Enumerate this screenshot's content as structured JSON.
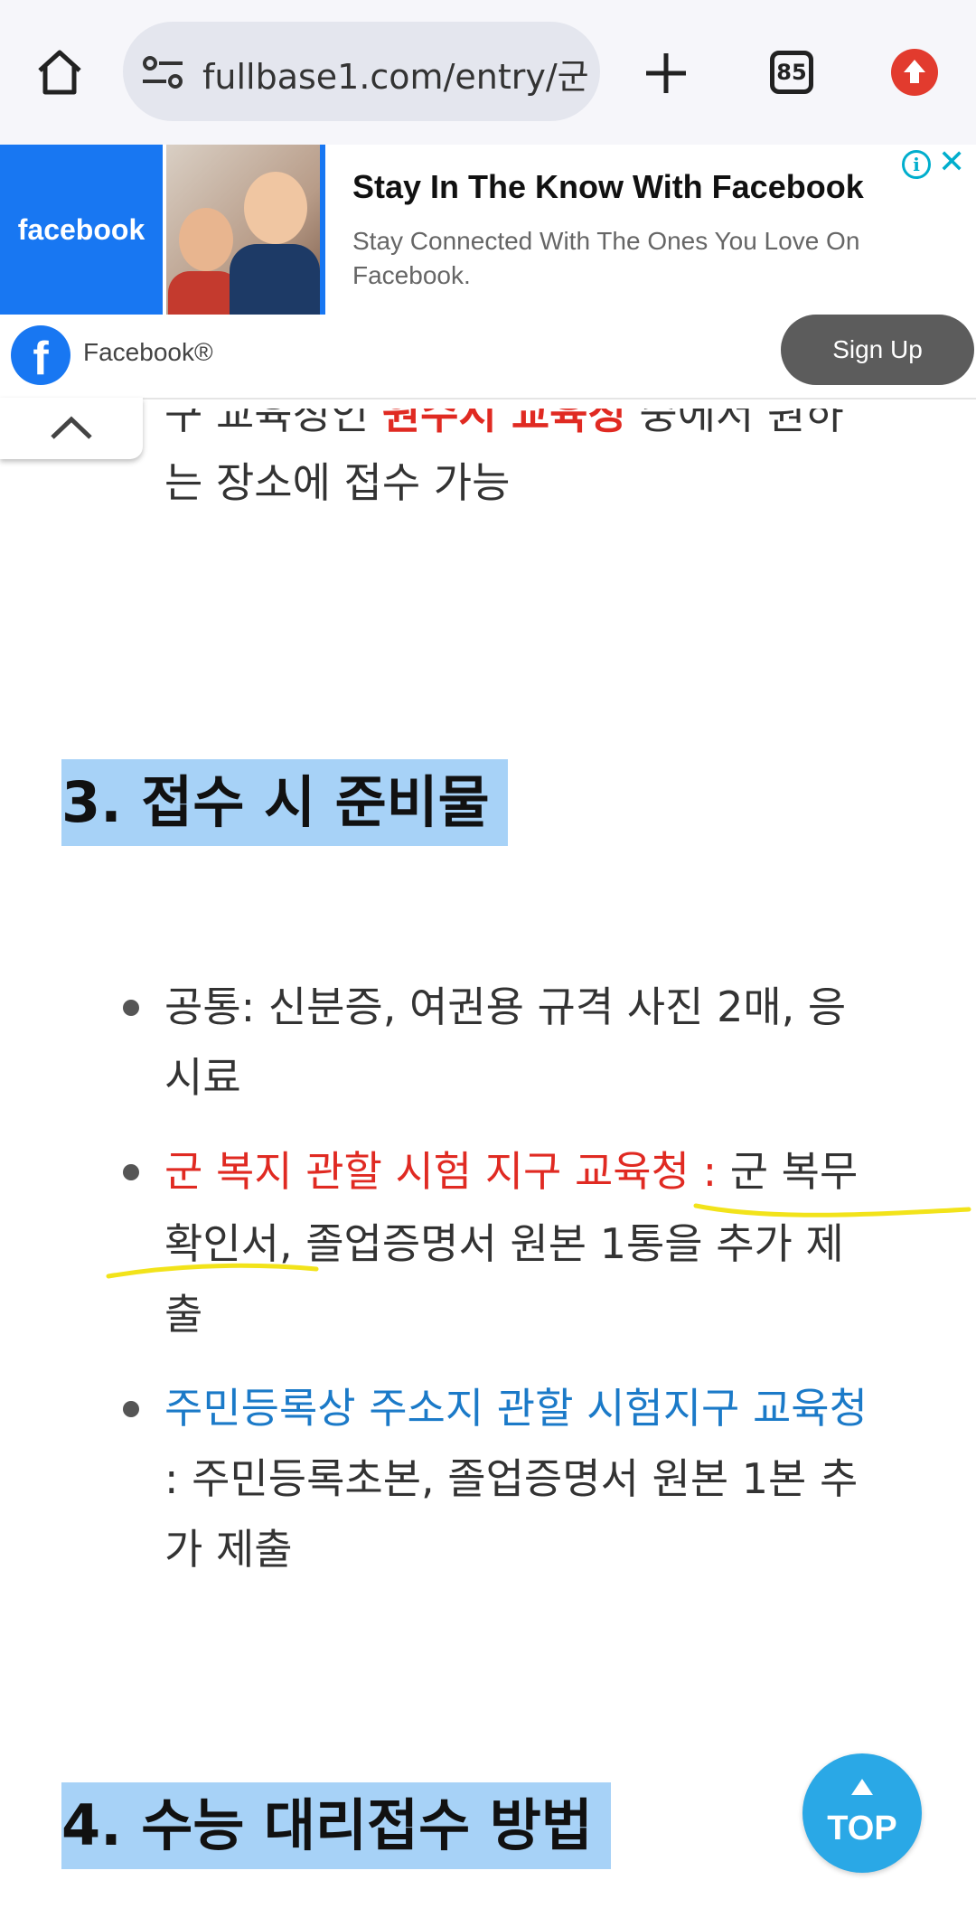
{
  "browser": {
    "url": "fullbase1.com/entry/군",
    "tab_count": "85"
  },
  "ad": {
    "logo_text": "facebook",
    "title": "Stay In The Know With Facebook",
    "description": "Stay Connected With The Ones You Love On Facebook.",
    "brand": "Facebook®",
    "cta": "Sign Up",
    "info_icon": "i",
    "close_icon": "✕"
  },
  "content": {
    "para_cont_1_pre": "구 교육청인 ",
    "para_cont_1_red": "원수시 교육청",
    "para_cont_1_post": " 중에서 원하",
    "para_cont_2": "는 장소에 접수 가능",
    "heading3": "3. 접수 시 준비물",
    "items": [
      {
        "lines": [
          "공통: 신분증, 여권용 규격 사진 2매, 응",
          "시료"
        ]
      },
      {
        "label": "군 복지 관할 시험 지구 교육청 :",
        "line1_rest": " 군 복무",
        "lines": [
          "확인서, 졸업증명서 원본 1통을 추가 제",
          "출"
        ]
      },
      {
        "label": "주민등록상 주소지 관할 시험지구 교육청",
        "lines": [
          ": 주민등록초본, 졸업증명서 원본 1본 추",
          "가 제출"
        ]
      }
    ],
    "heading4": "4. 수능 대리접수 방법"
  },
  "top_button": "TOP",
  "colors": {
    "accent_red": "#e02a22",
    "link_blue": "#1b7ac8",
    "heading_highlight": "#a7d2f7",
    "facebook_blue": "#1877f2",
    "marker_yellow": "#f2e31a"
  }
}
